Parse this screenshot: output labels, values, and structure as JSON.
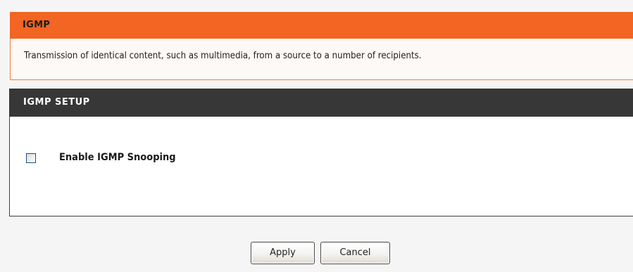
{
  "igmp": {
    "title": "IGMP",
    "description": "Transmission of identical content, such as multimedia, from a source to a number of recipients."
  },
  "setup": {
    "title": "IGMP SETUP",
    "enable_snooping_label": "Enable IGMP Snooping",
    "enable_snooping_checked": false
  },
  "buttons": {
    "apply_label": "Apply",
    "cancel_label": "Cancel"
  },
  "colors": {
    "igmp_header": "#f26522",
    "setup_header": "#373737"
  }
}
